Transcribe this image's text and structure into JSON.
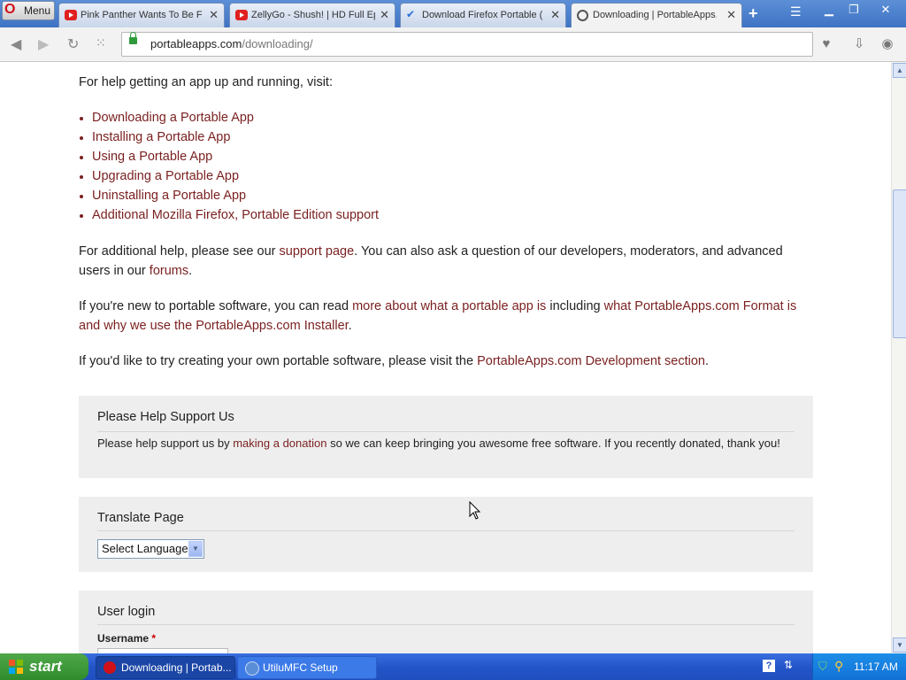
{
  "browser": {
    "menu_label": "Menu",
    "tabs": [
      {
        "title": "Pink Panther Wants To Be F",
        "icon": "youtube-icon"
      },
      {
        "title": "ZellyGo - Shush! | HD Full Ep",
        "icon": "youtube-icon"
      },
      {
        "title": "Download Firefox Portable (",
        "icon": "check-icon"
      },
      {
        "title": "Downloading | PortableApps.",
        "icon": "portableapps-icon",
        "active": true
      }
    ],
    "url_domain": "portableapps.com",
    "url_path": "/downloading/"
  },
  "page": {
    "intro": "For help getting an app up and running, visit:",
    "help_links": [
      "Downloading a Portable App",
      "Installing a Portable App",
      "Using a Portable App",
      "Upgrading a Portable App",
      "Uninstalling a Portable App",
      "Additional Mozilla Firefox, Portable Edition support"
    ],
    "p_support": {
      "t1": "For additional help, please see our ",
      "link1": "support page",
      "t2": ". You can also ask a question of our developers, moderators, and advanced users in our ",
      "link2": "forums",
      "t3": "."
    },
    "p_new": {
      "t1": "If you're new to portable software, you can read ",
      "link1": "more about what a portable app is",
      "t2": " including ",
      "link2": "what PortableApps.com Format is and why we use the PortableApps.com Installer",
      "t3": "."
    },
    "p_dev": {
      "t1": "If you'd like to try creating your own portable software, please visit the ",
      "link1": "PortableApps.com Development section",
      "t2": "."
    },
    "support_box": {
      "title": "Please Help Support Us",
      "t1": "Please help support us by ",
      "link": "making a donation",
      "t2": " so we can keep bringing you awesome free software. If you recently donated, thank you!"
    },
    "translate_box": {
      "title": "Translate Page",
      "select_value": "Select Language"
    },
    "login_box": {
      "title": "User login",
      "username_label": "Username",
      "required_mark": "*"
    }
  },
  "taskbar": {
    "start_label": "start",
    "items": [
      {
        "label": "Downloading | Portab...",
        "icon": "opera-icon"
      },
      {
        "label": "UtiluMFC Setup",
        "icon": "setup-icon"
      }
    ],
    "clock": "11:17 AM"
  }
}
